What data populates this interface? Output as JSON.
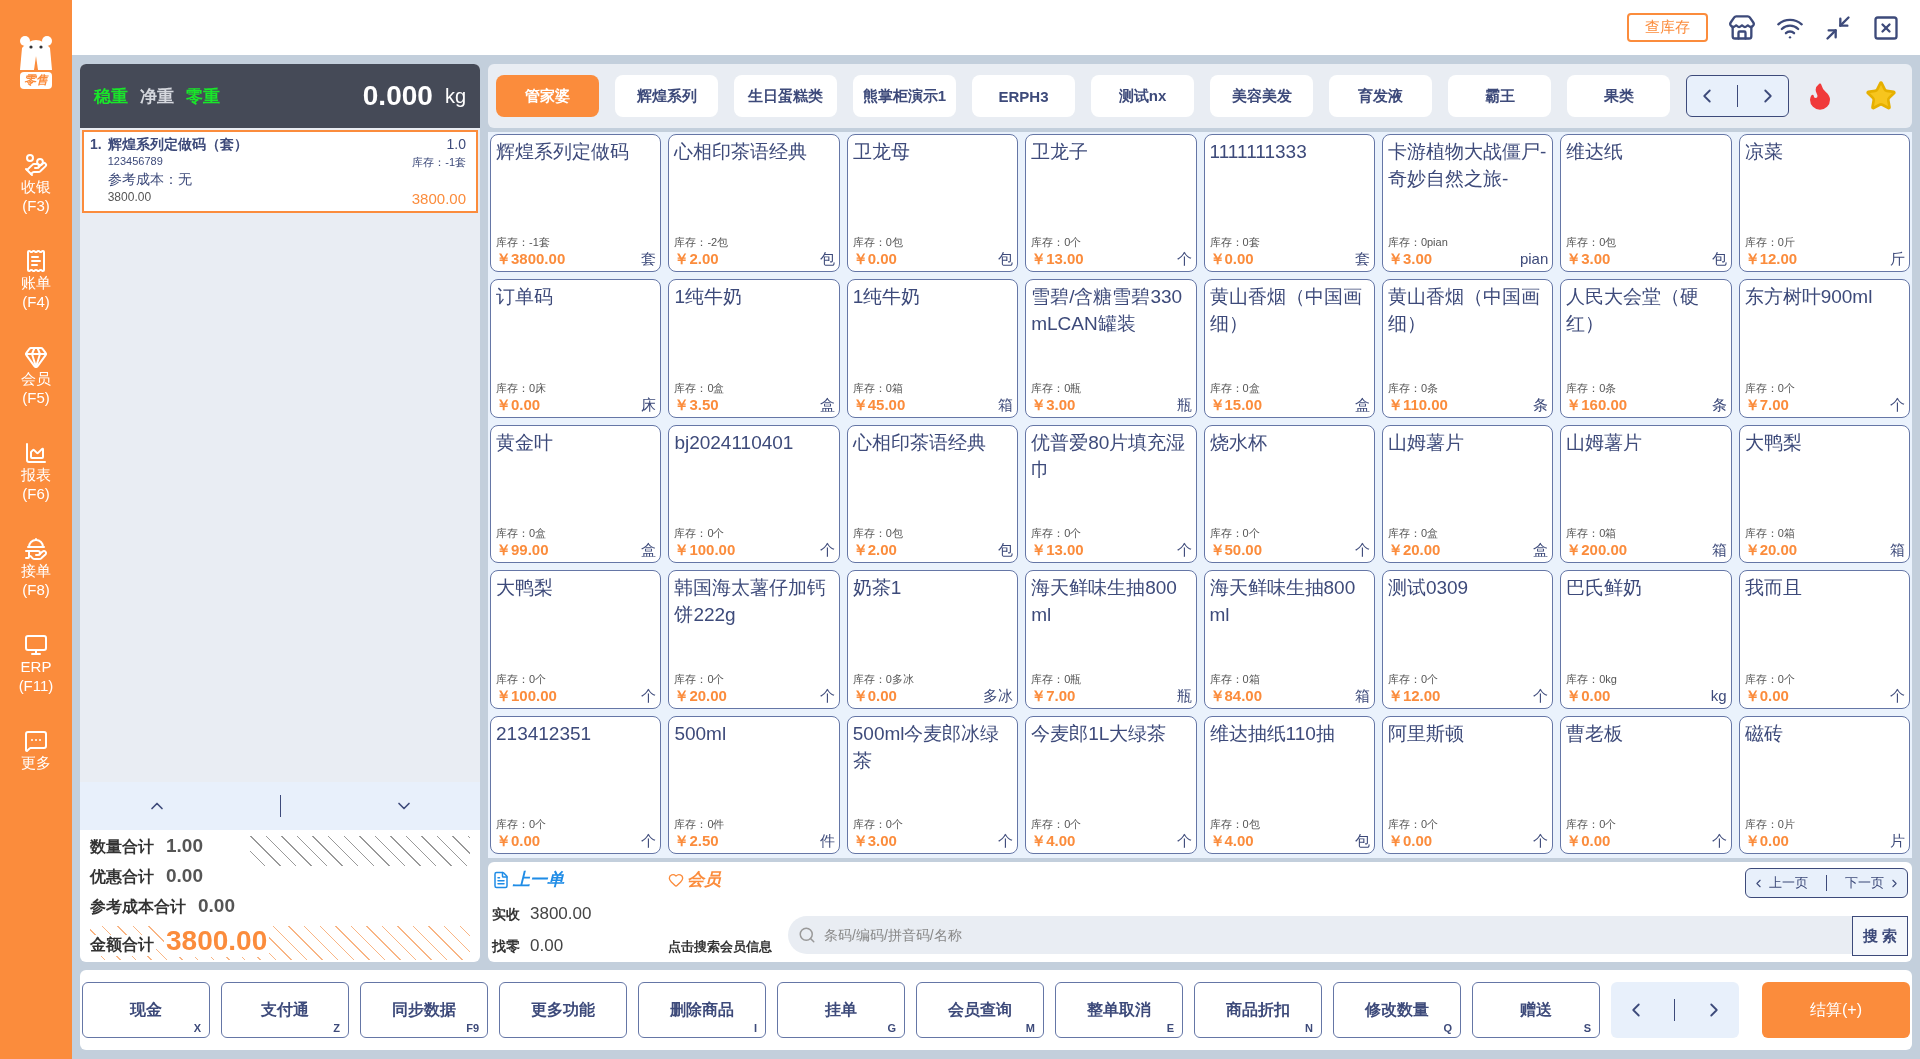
{
  "sidebar": {
    "logo_text": "零售",
    "items": [
      {
        "label": "收银",
        "key": "(F3)"
      },
      {
        "label": "账单",
        "key": "(F4)"
      },
      {
        "label": "会员",
        "key": "(F5)"
      },
      {
        "label": "报表",
        "key": "(F6)"
      },
      {
        "label": "接单",
        "key": "(F8)"
      },
      {
        "label": "ERP",
        "key": "(F11)"
      },
      {
        "label": "更多"
      }
    ]
  },
  "top_bar": {
    "stock_button": "查库存"
  },
  "scale": {
    "flags": [
      {
        "label": "稳重",
        "on": true
      },
      {
        "label": "净重",
        "on": false
      },
      {
        "label": "零重",
        "on": true
      }
    ],
    "weight": "0.000",
    "unit": "kg"
  },
  "cart": {
    "items": [
      {
        "index": "1.",
        "name": "辉煌系列定做码（套）",
        "qty": "1.0",
        "code": "123456789",
        "stock": "库存：-1套",
        "cost": "参考成本：无",
        "unit_price": "3800.00",
        "amount": "3800.00",
        "selected": true
      }
    ]
  },
  "totals": [
    {
      "label": "数量合计",
      "value": "1.00",
      "kind": "plain"
    },
    {
      "label": "优惠合计",
      "value": "0.00",
      "kind": "plain"
    },
    {
      "label": "参考成本合计",
      "value": "0.00",
      "kind": "plain"
    },
    {
      "label": "金额合计",
      "value": "3800.00",
      "kind": "total"
    }
  ],
  "categories": [
    {
      "label": "管家婆",
      "selected": true
    },
    {
      "label": "辉煌系列",
      "selected": false
    },
    {
      "label": "生日蛋糕类",
      "selected": false
    },
    {
      "label": "熊掌柜演示1",
      "selected": false
    },
    {
      "label": "ERPH3",
      "selected": false
    },
    {
      "label": "测试nx",
      "selected": false
    },
    {
      "label": "美容美发",
      "selected": false
    },
    {
      "label": "育发液",
      "selected": false
    },
    {
      "label": "霸王",
      "selected": false
    },
    {
      "label": "果类",
      "selected": false
    }
  ],
  "products": [
    {
      "name": "辉煌系列定做码",
      "stock": "库存：-1套",
      "price": "￥3800.00",
      "unit": "套"
    },
    {
      "name": "心相印茶语经典",
      "stock": "库存：-2包",
      "price": "￥2.00",
      "unit": "包"
    },
    {
      "name": "卫龙母",
      "stock": "库存：0包",
      "price": "￥0.00",
      "unit": "包"
    },
    {
      "name": "卫龙子",
      "stock": "库存：0个",
      "price": "￥13.00",
      "unit": "个"
    },
    {
      "name": "1111111333",
      "stock": "库存：0套",
      "price": "￥0.00",
      "unit": "套"
    },
    {
      "name": "卡游植物大战僵尸-奇妙自然之旅-",
      "stock": "库存：0pian",
      "price": "￥3.00",
      "unit": "pian"
    },
    {
      "name": "维达纸",
      "stock": "库存：0包",
      "price": "￥3.00",
      "unit": "包"
    },
    {
      "name": "凉菜",
      "stock": "库存：0斤",
      "price": "￥12.00",
      "unit": "斤"
    },
    {
      "name": "订单码",
      "stock": "库存：0床",
      "price": "￥0.00",
      "unit": "床"
    },
    {
      "name": "1纯牛奶",
      "stock": "库存：0盒",
      "price": "￥3.50",
      "unit": "盒"
    },
    {
      "name": "1纯牛奶",
      "stock": "库存：0箱",
      "price": "￥45.00",
      "unit": "箱"
    },
    {
      "name": "雪碧/含糖雪碧330mLCAN罐装",
      "stock": "库存：0瓶",
      "price": "￥3.00",
      "unit": "瓶"
    },
    {
      "name": "黄山香烟（中国画细）",
      "stock": "库存：0盒",
      "price": "￥15.00",
      "unit": "盒"
    },
    {
      "name": "黄山香烟（中国画细）",
      "stock": "库存：0条",
      "price": "￥110.00",
      "unit": "条"
    },
    {
      "name": "人民大会堂（硬红）",
      "stock": "库存：0条",
      "price": "￥160.00",
      "unit": "条"
    },
    {
      "name": "东方树叶900ml",
      "stock": "库存：0个",
      "price": "￥7.00",
      "unit": "个"
    },
    {
      "name": "黄金叶",
      "stock": "库存：0盒",
      "price": "￥99.00",
      "unit": "盒"
    },
    {
      "name": "bj2024110401",
      "stock": "库存：0个",
      "price": "￥100.00",
      "unit": "个"
    },
    {
      "name": "心相印茶语经典",
      "stock": "库存：0包",
      "price": "￥2.00",
      "unit": "包"
    },
    {
      "name": "优普爱80片填充湿巾",
      "stock": "库存：0个",
      "price": "￥13.00",
      "unit": "个"
    },
    {
      "name": "烧水杯",
      "stock": "库存：0个",
      "price": "￥50.00",
      "unit": "个"
    },
    {
      "name": "山姆薯片",
      "stock": "库存：0盒",
      "price": "￥20.00",
      "unit": "盒"
    },
    {
      "name": "山姆薯片",
      "stock": "库存：0箱",
      "price": "￥200.00",
      "unit": "箱"
    },
    {
      "name": "大鸭梨",
      "stock": "库存：0箱",
      "price": "￥20.00",
      "unit": "箱"
    },
    {
      "name": "大鸭梨",
      "stock": "库存：0个",
      "price": "￥100.00",
      "unit": "个"
    },
    {
      "name": "韩国海太薯仔加钙饼222g",
      "stock": "库存：0个",
      "price": "￥20.00",
      "unit": "个"
    },
    {
      "name": "奶茶1",
      "stock": "库存：0多冰",
      "price": "￥0.00",
      "unit": "多冰"
    },
    {
      "name": "海天鲜味生抽800ml",
      "stock": "库存：0瓶",
      "price": "￥7.00",
      "unit": "瓶"
    },
    {
      "name": "海天鲜味生抽800ml",
      "stock": "库存：0箱",
      "price": "￥84.00",
      "unit": "箱"
    },
    {
      "name": "测试0309",
      "stock": "库存：0个",
      "price": "￥12.00",
      "unit": "个"
    },
    {
      "name": "巴氏鲜奶",
      "stock": "库存：0kg",
      "price": "￥0.00",
      "unit": "kg"
    },
    {
      "name": "我而且",
      "stock": "库存：0个",
      "price": "￥0.00",
      "unit": "个"
    },
    {
      "name": "213412351",
      "stock": "库存：0个",
      "price": "￥0.00",
      "unit": "个"
    },
    {
      "name": "500ml",
      "stock": "库存：0件",
      "price": "￥2.50",
      "unit": "件"
    },
    {
      "name": "500ml今麦郎冰绿茶",
      "stock": "库存：0个",
      "price": "￥3.00",
      "unit": "个"
    },
    {
      "name": "今麦郎1L大绿茶",
      "stock": "库存：0个",
      "price": "￥4.00",
      "unit": "个"
    },
    {
      "name": "维达抽纸110抽",
      "stock": "库存：0包",
      "price": "￥4.00",
      "unit": "包"
    },
    {
      "name": "阿里斯顿",
      "stock": "库存：0个",
      "price": "￥0.00",
      "unit": "个"
    },
    {
      "name": "曹老板",
      "stock": "库存：0个",
      "price": "￥0.00",
      "unit": "个"
    },
    {
      "name": "磁砖",
      "stock": "库存：0片",
      "price": "￥0.00",
      "unit": "片"
    }
  ],
  "info": {
    "last_order": "上一单",
    "member": "会员",
    "received_label": "实收",
    "received": "3800.00",
    "change_label": "找零",
    "change": "0.00",
    "member_hint": "点击搜索会员信息",
    "prev_page": "上一页",
    "next_page": "下一页",
    "search_placeholder": "条码/编码/拼音码/名称",
    "search_button": "搜 索"
  },
  "actions": [
    {
      "label": "现金",
      "key": "X"
    },
    {
      "label": "支付通",
      "key": "Z"
    },
    {
      "label": "同步数据",
      "key": "F9"
    },
    {
      "label": "更多功能"
    },
    {
      "label": "删除商品",
      "key": "I"
    },
    {
      "label": "挂单",
      "key": "G"
    },
    {
      "label": "会员查询",
      "key": "M"
    },
    {
      "label": "整单取消",
      "key": "E"
    },
    {
      "label": "商品折扣",
      "key": "N"
    },
    {
      "label": "修改数量",
      "key": "Q"
    },
    {
      "label": "赠送",
      "key": "S"
    }
  ],
  "checkout_button": "结算(+)"
}
